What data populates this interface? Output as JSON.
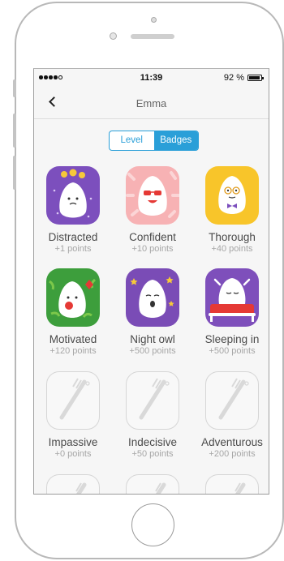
{
  "status": {
    "time": "11:39",
    "battery": "92 %"
  },
  "nav": {
    "title": "Emma"
  },
  "segments": {
    "level": "Level",
    "badges": "Badges"
  },
  "badges": [
    {
      "name": "Distracted",
      "points": "+1 points",
      "locked": false,
      "bg": "#7c4fbd"
    },
    {
      "name": "Confident",
      "points": "+10 points",
      "locked": false,
      "bg": "#f7b2b4"
    },
    {
      "name": "Thorough",
      "points": "+40 points",
      "locked": false,
      "bg": "#f8c52a"
    },
    {
      "name": "Motivated",
      "points": "+120 points",
      "locked": false,
      "bg": "#3d9e3c"
    },
    {
      "name": "Night owl",
      "points": "+500 points",
      "locked": false,
      "bg": "#7a4cb6"
    },
    {
      "name": "Sleeping in",
      "points": "+500 points",
      "locked": false,
      "bg": "#7e4fbb"
    },
    {
      "name": "Impassive",
      "points": "+0 points",
      "locked": true
    },
    {
      "name": "Indecisive",
      "points": "+50 points",
      "locked": true
    },
    {
      "name": "Adventurous",
      "points": "+200 points",
      "locked": true
    }
  ]
}
